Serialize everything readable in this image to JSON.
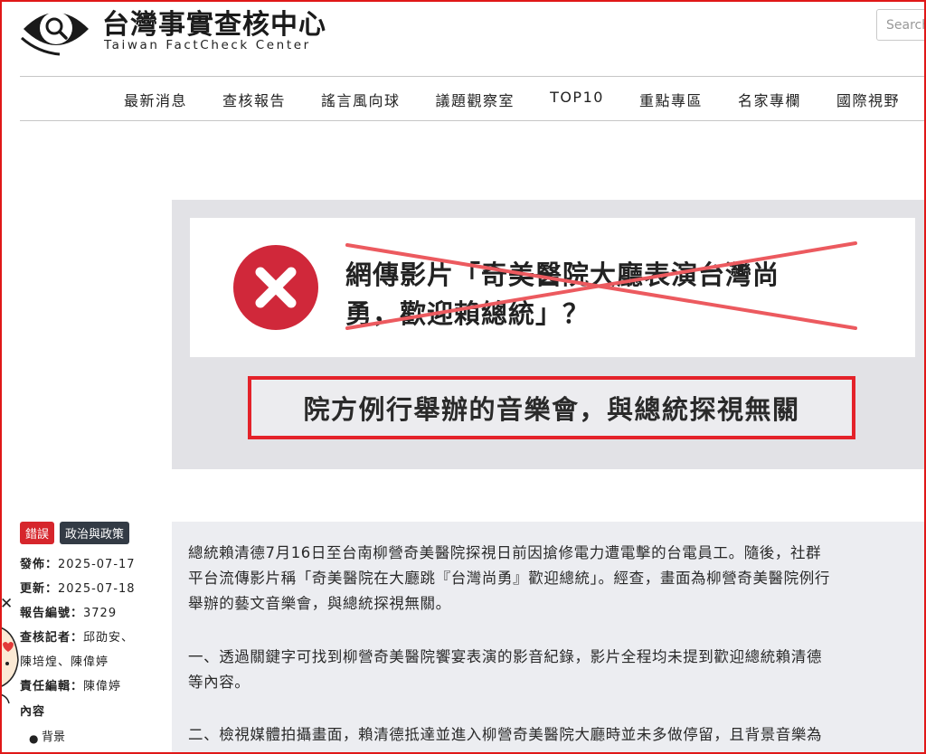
{
  "header": {
    "title": "台灣事實查核中心",
    "subtitle": "Taiwan FactCheck Center",
    "search_placeholder": "Search"
  },
  "nav": {
    "items": [
      "最新消息",
      "查核報告",
      "謠言風向球",
      "議題觀察室",
      "TOP10",
      "重點專區",
      "名家專欄",
      "國際視野"
    ]
  },
  "hero": {
    "claim_line1": "網傳影片「奇美醫院大廳表演台灣尚",
    "claim_line2": "勇，歡迎賴總統」？",
    "verdict": "院方例行舉辦的音樂會，與總統探視無關",
    "x_icon": "close-circle-icon",
    "accent_color": "#e4222a",
    "icon_color": "#d0283a"
  },
  "sidebar": {
    "tag_verdict": "錯誤",
    "tag_category": "政治與政策",
    "published_label": "發佈：",
    "published": "2025-07-17",
    "updated_label": "更新：",
    "updated": "2025-07-18",
    "report_no_label": "報告編號：",
    "report_no": "3729",
    "reporters_label": "查核記者：",
    "reporters_line1": "邱劭安、",
    "reporters_line2": "陳培煌、陳偉婷",
    "editor_label": "責任編輯：",
    "editor": "陳偉婷",
    "contents_label": "內容",
    "toc_item": "背景",
    "close_symbol": "✕"
  },
  "article": {
    "p1_line1": "總統賴清德7月16日至台南柳營奇美醫院探視日前因搶修電力遭電擊的台電員工。隨後，社群",
    "p1_line2": "平台流傳影片稱「奇美醫院在大廳跳『台灣尚勇』歡迎總統」。經查，畫面為柳營奇美醫院例行",
    "p1_line3": "舉辦的藝文音樂會，與總統探視無關。",
    "p2_line1": "一、透過關鍵字可找到柳營奇美醫院饗宴表演的影音紀錄，影片全程均未提到歡迎總統賴清德",
    "p2_line2": "等內容。",
    "p3_line1": "二、檢視媒體拍攝畫面，賴清德抵達並進入柳營奇美醫院大廳時並未多做停留，且背景音樂為"
  }
}
